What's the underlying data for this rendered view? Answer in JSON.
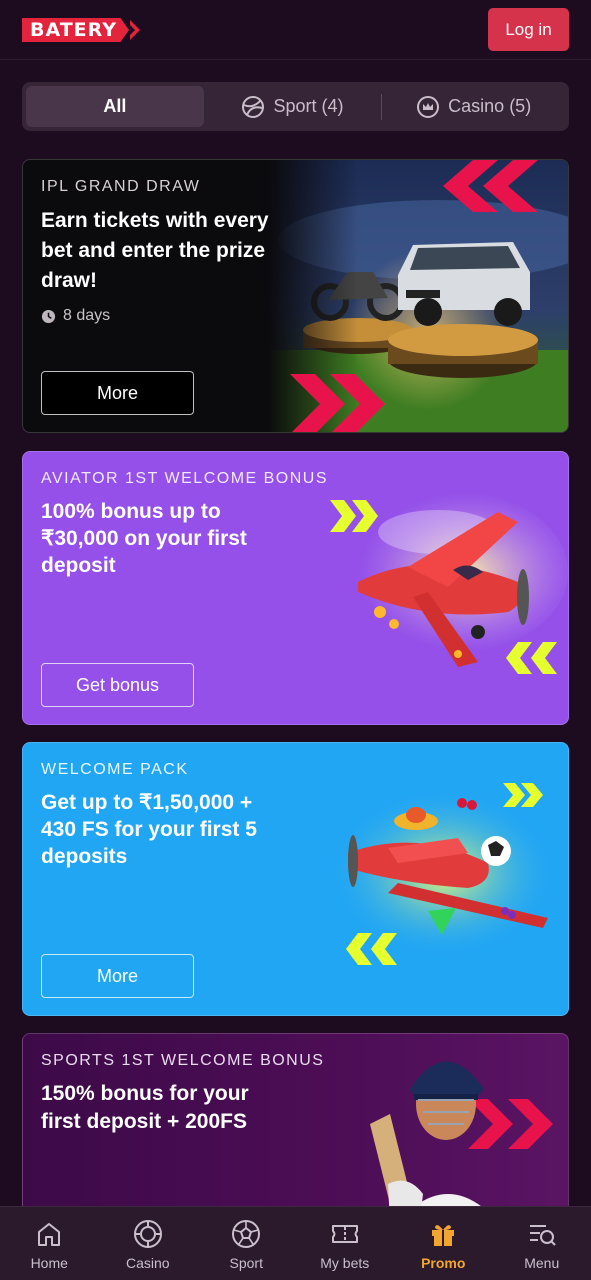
{
  "header": {
    "logo_text": "BATERY",
    "login_label": "Log in"
  },
  "filters": {
    "all": "All",
    "sport": "Sport (4)",
    "casino": "Casino (5)"
  },
  "promos": [
    {
      "eyebrow": "IPL GRAND DRAW",
      "title": "Earn tickets with every bet and enter the prize draw!",
      "time_left": "8 days",
      "button": "More"
    },
    {
      "eyebrow": "AVIATOR 1ST WELCOME BONUS",
      "title": "100% bonus up to ₹30,000 on your first deposit",
      "button": "Get bonus"
    },
    {
      "eyebrow": "WELCOME PACK",
      "title": "Get up to ₹1,50,000 + 430 FS for your first 5 deposits",
      "button": "More"
    },
    {
      "eyebrow": "SPORTS 1ST WELCOME BONUS",
      "title": "150% bonus for your first deposit + 200FS"
    }
  ],
  "nav": {
    "home": "Home",
    "casino": "Casino",
    "sport": "Sport",
    "mybets": "My bets",
    "promo": "Promo",
    "menu": "Menu"
  },
  "colors": {
    "brand_red": "#e4233d",
    "login_button": "#d5334b",
    "background": "#1d0b1f",
    "promo_active": "#f2a630",
    "aviator_card": "#9450e8",
    "welcome_pack_card": "#21a6f4"
  }
}
